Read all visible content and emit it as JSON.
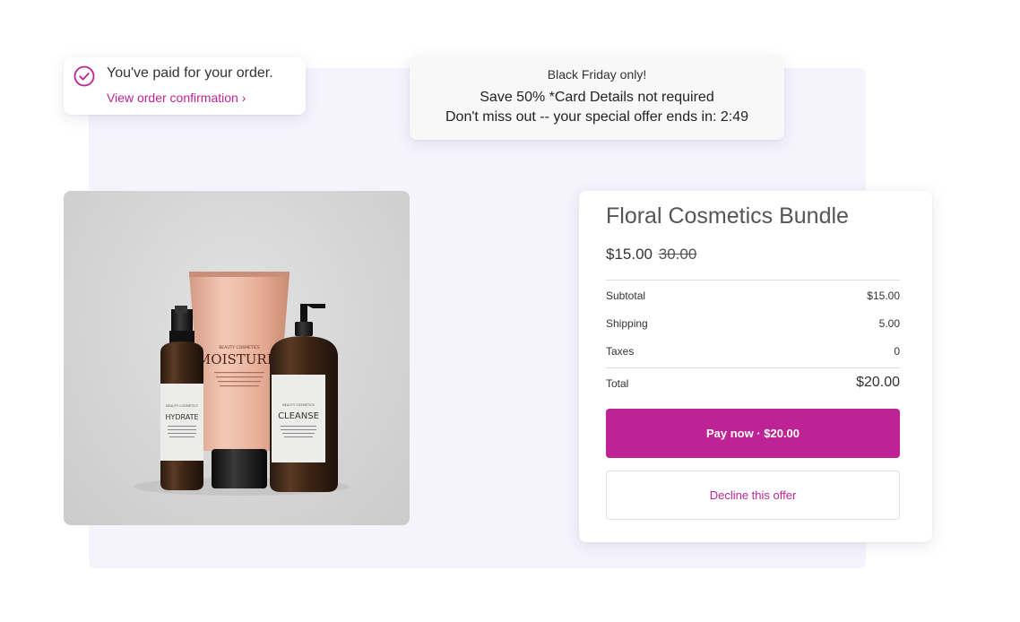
{
  "theme": {
    "accent": "#bd2394",
    "backdrop": "#f5f4fd"
  },
  "payment_notice": {
    "icon": "check-circle-icon",
    "title": "You've paid for your order.",
    "link_label": "View order confirmation ›"
  },
  "promo": {
    "tag": "Black Friday only!",
    "headline": "Save 50% *Card Details not required",
    "countdown_text": "Don't miss out -- your special offer ends in: 2:49"
  },
  "product_image": {
    "bottles": [
      {
        "brand": "BEAUTY COSMETICS",
        "name": "HYDRATE"
      },
      {
        "brand": "BEAUTY COSMETICS",
        "name": "MOISTURIZ"
      },
      {
        "brand": "BEAUTY COSMETICS",
        "name": "CLEANSE"
      }
    ]
  },
  "offer": {
    "product_name": "Floral Cosmetics Bundle",
    "price": "$15.00",
    "original_price": "30.00",
    "summary": {
      "subtotal_label": "Subtotal",
      "subtotal_value": "$15.00",
      "shipping_label": "Shipping",
      "shipping_value": "5.00",
      "taxes_label": "Taxes",
      "taxes_value": "0",
      "total_label": "Total",
      "total_value": "$20.00"
    },
    "pay_button": "Pay now · $20.00",
    "decline_button": "Decline this offer"
  }
}
